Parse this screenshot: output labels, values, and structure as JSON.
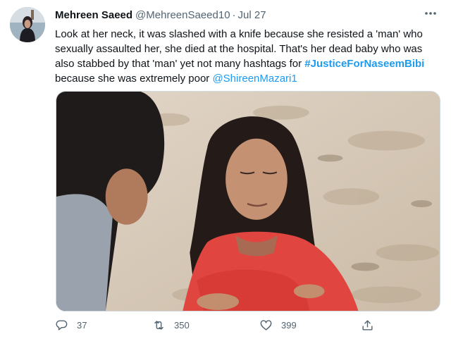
{
  "tweet": {
    "author": {
      "name": "Mehreen Saeed",
      "handle": "@MehreenSaeed10"
    },
    "separator": "·",
    "date": "Jul 27",
    "more_icon": "more-icon",
    "text": {
      "part1": "Look at her neck, it was slashed with a knife because she resisted a 'man' who sexually assaulted her, she died at the hospital. That's her dead baby who was also stabbed by that 'man' yet not many hashtags for ",
      "hashtag": "#JusticeForNaseemBibi",
      "part2": " because she was extremely poor ",
      "mention": "@ShireenMazari1"
    },
    "media": {
      "type": "photo",
      "description": "Photo of a woman in red with eyes closed"
    },
    "actions": {
      "reply": {
        "icon": "reply-icon",
        "count": "37"
      },
      "retweet": {
        "icon": "retweet-icon",
        "count": "350"
      },
      "like": {
        "icon": "like-icon",
        "count": "399"
      },
      "share": {
        "icon": "share-icon"
      }
    },
    "colors": {
      "link": "#1d9bf0",
      "secondary_text": "#536471",
      "primary_text": "#0f1419"
    }
  }
}
